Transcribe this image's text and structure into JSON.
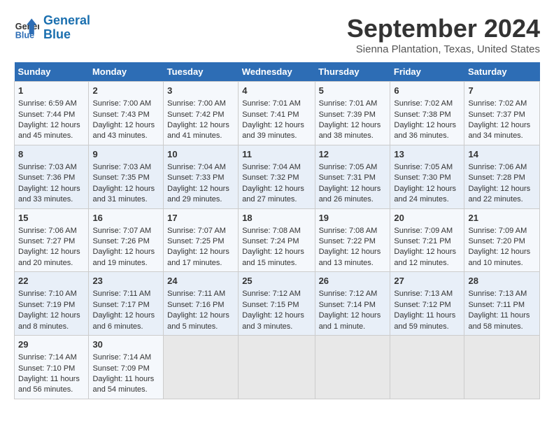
{
  "header": {
    "logo_line1": "General",
    "logo_line2": "Blue",
    "month_title": "September 2024",
    "subtitle": "Sienna Plantation, Texas, United States"
  },
  "days_of_week": [
    "Sunday",
    "Monday",
    "Tuesday",
    "Wednesday",
    "Thursday",
    "Friday",
    "Saturday"
  ],
  "weeks": [
    [
      {
        "day": "1",
        "info": "Sunrise: 6:59 AM\nSunset: 7:44 PM\nDaylight: 12 hours\nand 45 minutes."
      },
      {
        "day": "2",
        "info": "Sunrise: 7:00 AM\nSunset: 7:43 PM\nDaylight: 12 hours\nand 43 minutes."
      },
      {
        "day": "3",
        "info": "Sunrise: 7:00 AM\nSunset: 7:42 PM\nDaylight: 12 hours\nand 41 minutes."
      },
      {
        "day": "4",
        "info": "Sunrise: 7:01 AM\nSunset: 7:41 PM\nDaylight: 12 hours\nand 39 minutes."
      },
      {
        "day": "5",
        "info": "Sunrise: 7:01 AM\nSunset: 7:39 PM\nDaylight: 12 hours\nand 38 minutes."
      },
      {
        "day": "6",
        "info": "Sunrise: 7:02 AM\nSunset: 7:38 PM\nDaylight: 12 hours\nand 36 minutes."
      },
      {
        "day": "7",
        "info": "Sunrise: 7:02 AM\nSunset: 7:37 PM\nDaylight: 12 hours\nand 34 minutes."
      }
    ],
    [
      {
        "day": "8",
        "info": "Sunrise: 7:03 AM\nSunset: 7:36 PM\nDaylight: 12 hours\nand 33 minutes."
      },
      {
        "day": "9",
        "info": "Sunrise: 7:03 AM\nSunset: 7:35 PM\nDaylight: 12 hours\nand 31 minutes."
      },
      {
        "day": "10",
        "info": "Sunrise: 7:04 AM\nSunset: 7:33 PM\nDaylight: 12 hours\nand 29 minutes."
      },
      {
        "day": "11",
        "info": "Sunrise: 7:04 AM\nSunset: 7:32 PM\nDaylight: 12 hours\nand 27 minutes."
      },
      {
        "day": "12",
        "info": "Sunrise: 7:05 AM\nSunset: 7:31 PM\nDaylight: 12 hours\nand 26 minutes."
      },
      {
        "day": "13",
        "info": "Sunrise: 7:05 AM\nSunset: 7:30 PM\nDaylight: 12 hours\nand 24 minutes."
      },
      {
        "day": "14",
        "info": "Sunrise: 7:06 AM\nSunset: 7:28 PM\nDaylight: 12 hours\nand 22 minutes."
      }
    ],
    [
      {
        "day": "15",
        "info": "Sunrise: 7:06 AM\nSunset: 7:27 PM\nDaylight: 12 hours\nand 20 minutes."
      },
      {
        "day": "16",
        "info": "Sunrise: 7:07 AM\nSunset: 7:26 PM\nDaylight: 12 hours\nand 19 minutes."
      },
      {
        "day": "17",
        "info": "Sunrise: 7:07 AM\nSunset: 7:25 PM\nDaylight: 12 hours\nand 17 minutes."
      },
      {
        "day": "18",
        "info": "Sunrise: 7:08 AM\nSunset: 7:24 PM\nDaylight: 12 hours\nand 15 minutes."
      },
      {
        "day": "19",
        "info": "Sunrise: 7:08 AM\nSunset: 7:22 PM\nDaylight: 12 hours\nand 13 minutes."
      },
      {
        "day": "20",
        "info": "Sunrise: 7:09 AM\nSunset: 7:21 PM\nDaylight: 12 hours\nand 12 minutes."
      },
      {
        "day": "21",
        "info": "Sunrise: 7:09 AM\nSunset: 7:20 PM\nDaylight: 12 hours\nand 10 minutes."
      }
    ],
    [
      {
        "day": "22",
        "info": "Sunrise: 7:10 AM\nSunset: 7:19 PM\nDaylight: 12 hours\nand 8 minutes."
      },
      {
        "day": "23",
        "info": "Sunrise: 7:11 AM\nSunset: 7:17 PM\nDaylight: 12 hours\nand 6 minutes."
      },
      {
        "day": "24",
        "info": "Sunrise: 7:11 AM\nSunset: 7:16 PM\nDaylight: 12 hours\nand 5 minutes."
      },
      {
        "day": "25",
        "info": "Sunrise: 7:12 AM\nSunset: 7:15 PM\nDaylight: 12 hours\nand 3 minutes."
      },
      {
        "day": "26",
        "info": "Sunrise: 7:12 AM\nSunset: 7:14 PM\nDaylight: 12 hours\nand 1 minute."
      },
      {
        "day": "27",
        "info": "Sunrise: 7:13 AM\nSunset: 7:12 PM\nDaylight: 11 hours\nand 59 minutes."
      },
      {
        "day": "28",
        "info": "Sunrise: 7:13 AM\nSunset: 7:11 PM\nDaylight: 11 hours\nand 58 minutes."
      }
    ],
    [
      {
        "day": "29",
        "info": "Sunrise: 7:14 AM\nSunset: 7:10 PM\nDaylight: 11 hours\nand 56 minutes."
      },
      {
        "day": "30",
        "info": "Sunrise: 7:14 AM\nSunset: 7:09 PM\nDaylight: 11 hours\nand 54 minutes."
      },
      {
        "day": "",
        "info": ""
      },
      {
        "day": "",
        "info": ""
      },
      {
        "day": "",
        "info": ""
      },
      {
        "day": "",
        "info": ""
      },
      {
        "day": "",
        "info": ""
      }
    ]
  ]
}
